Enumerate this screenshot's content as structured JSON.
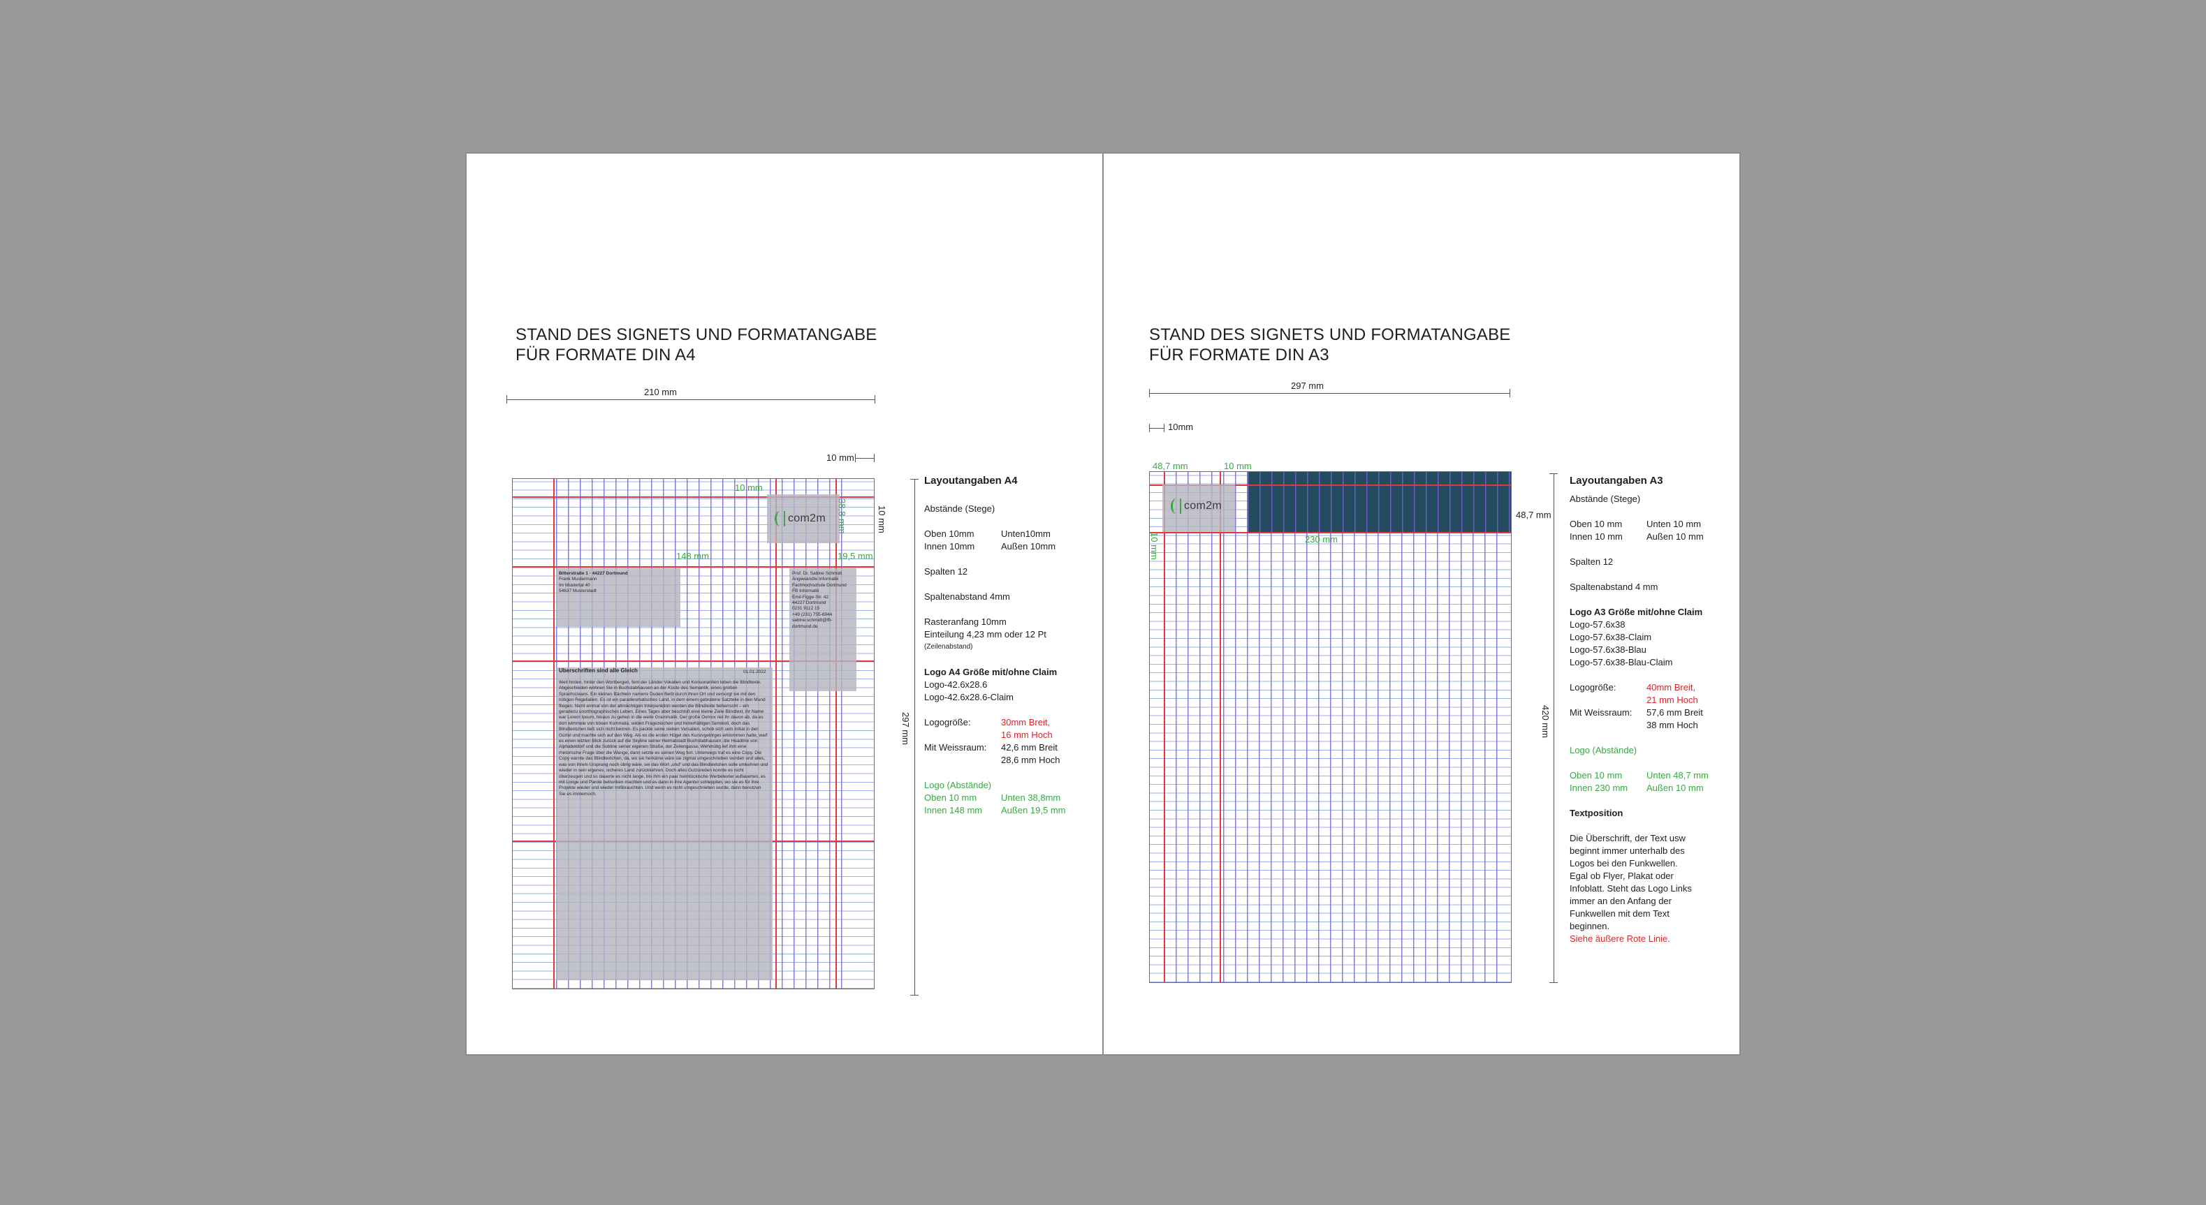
{
  "a4": {
    "heading": "STAND DES SIGNETS UND FORMATANGABE\nFÜR FORMATE DIN A4",
    "width_label": "210 mm",
    "margin_label": "10 mm",
    "height_label": "297 mm",
    "top_green": "10 mm",
    "green_148": "148 mm",
    "green_195": "19,5 mm",
    "green_388": "38,8 mm",
    "right_10": "10 mm",
    "logo_text": "com2m",
    "address_left": [
      "Bitterstraße 1 · 44227 Dortmund",
      "Frank Mustermann",
      "Im Mustertal 40",
      "54637 Musterstadt"
    ],
    "address_right": [
      "Prof. Dr. Sabine Schmidt",
      "Angewandte Informatik",
      "",
      "Fachhochschule Dortmund",
      "FB Informatik",
      "Emil-Figge-Str. 42",
      "44227 Dortmund",
      "",
      "0231 9112 15",
      "+49 (231) 755-6944",
      "sabine.schmidt@fh-dortmund.de"
    ],
    "letter_heading": "Überschriften sind alle Gleich",
    "letter_date": "01.01.2022",
    "letter_body": "Weit hinten, hinter den Wortbergen, fern der Länder Vokalien und Konsonantien leben die Blindtexte. Abgeschieden wohnen Sie in Buchstabhausen an der Küste des Semantik, eines großen Sprachozeans. Ein kleines Bächlein namens Duden fließt durch ihren Ort und versorgt sie mit den nötigen Regelialien. Es ist ein paradiesmatisches Land, in dem einem gebratene Satzteile in den Mund fliegen. Nicht einmal von der allmächtigen Interpunktion werden die Blindtexte beherrscht – ein geradezu unorthographisches Leben. Eines Tages aber beschloß eine kleine Zeile Blindtext, ihr Name war Lorem Ipsum, hinaus zu gehen in die weite Grammatik. Der große Oxmox riet ihr davon ab, da es dort wimmele von bösen Kommata, wilden Fragezeichen und hinterhältigen Semikoli, doch das Blindtextchen ließ sich nicht beirren. Es packte seine sieben Versalien, schob sich sein Initial in den Gürtel und machte sich auf den Weg. Als es die ersten Hügel des Kursivgebirges erklommen hatte, warf es einen letzten Blick zurück auf die Skyline seiner Heimatstadt Buchstabhausen, die Headline von Alphabetdorf und die Subline seiner eigenen Straße, der Zeilengasse. Wehmütig lief ihm eine rhetorische Frage über die Wange, dann setzte es seinen Weg fort. Unterwegs traf es eine Copy. Die Copy warnte das Blindtextchen, da, wo sie herkäme wäre sie zigmal umgeschrieben worden und alles, was von ihrem Ursprung noch übrig wäre, sei das Wort „und“ und das Blindtextchen solle umkehren und wieder in sein eigenes, sicheres Land zurückkehren. Doch alles Gutzureden konnte es nicht überzeugen und so dauerte es nicht lange, bis ihm ein paar heimtückische Werbetexter auflauerten, es mit Longe und Parole betrunken machten und es dann in ihre Agentur schleppten, wo sie es für ihre Projekte wieder und wieder mißbrauchten. Und wenn es nicht umgeschrieben wurde, dann benutzen Sie es immernoch.",
    "specs": {
      "title": "Layoutangaben A4",
      "stege": "Abstände (Stege)",
      "oben": "Oben 10mm",
      "unten": "Unten10mm",
      "innen": "Innen 10mm",
      "aussen": "Außen 10mm",
      "spalten": "Spalten 12",
      "spaltenabstand": "Spaltenabstand 4mm",
      "raster1": "Rasteranfang 10mm",
      "raster2": "Einteilung 4,23 mm oder 12 Pt",
      "raster3": "(Zeilenabstand)",
      "logo_title": "Logo A4 Größe mit/ohne Claim",
      "logo1": "Logo-42.6x28.6",
      "logo2": "Logo-42.6x28.6-Claim",
      "groesse_label": "Logogröße:",
      "groesse1": "30mm Breit,",
      "groesse2": "16 mm Hoch",
      "weiss_label": "Mit Weissraum:",
      "weiss1": "42,6 mm Breit",
      "weiss2": "28,6  mm Hoch",
      "abst_title": "Logo (Abstände)",
      "abst_oben": "Oben 10 mm",
      "abst_unten": "Unten 38,8mm",
      "abst_innen": "Innen 148 mm",
      "abst_aussen": "Außen 19,5 mm"
    }
  },
  "a3": {
    "heading": "STAND DES SIGNETS UND FORMATANGABE\nFÜR FORMATE DIN A3",
    "width_label": "297 mm",
    "margin_label": "10mm",
    "height_label": "420 mm",
    "green_487": "48,7 mm",
    "green_10": "10 mm",
    "band_label": "48,7 mm",
    "green_230": "230 mm",
    "left_vert": "10 mm",
    "logo_text": "com2m",
    "specs": {
      "title": "Layoutangaben A3",
      "stege": "Abstände (Stege)",
      "oben": "Oben 10 mm",
      "unten": "Unten 10 mm",
      "innen": "Innen 10 mm",
      "aussen": "Außen 10 mm",
      "spalten": "Spalten 12",
      "spaltenabstand": "Spaltenabstand 4 mm",
      "logo_title": "Logo A3 Größe mit/ohne Claim",
      "logo1": "Logo-57.6x38",
      "logo2": "Logo-57.6x38-Claim",
      "logo3": "Logo-57.6x38-Blau",
      "logo4": "Logo-57.6x38-Blau-Claim",
      "groesse_label": "Logogröße:",
      "groesse1": "40mm Breit,",
      "groesse2": "21 mm Hoch",
      "weiss_label": "Mit Weissraum:",
      "weiss1": "57,6 mm Breit",
      "weiss2": "38  mm Hoch",
      "abst_title": "Logo (Abstände)",
      "abst_oben": "Oben 10 mm",
      "abst_unten": "Unten 48,7 mm",
      "abst_innen": "Innen 230 mm",
      "abst_aussen": "Außen 10 mm",
      "text_title": "Textposition",
      "text_body": "Die Überschrift, der Text usw beginnt immer unterhalb des Logos bei den Funkwellen. Egal ob Flyer, Plakat oder Infoblatt. Steht das Logo Links immer an den Anfang der Funkwellen mit dem Text beginnen.",
      "text_red": "Siehe äußere Rote Linie."
    }
  },
  "colors": {
    "grid_purple": "#7a60d6",
    "grid_blue": "#466ed2",
    "guide_red": "#e0393c",
    "accent_green": "#39a845",
    "band_blue": "#234c61",
    "background": "#9a9a9a"
  }
}
